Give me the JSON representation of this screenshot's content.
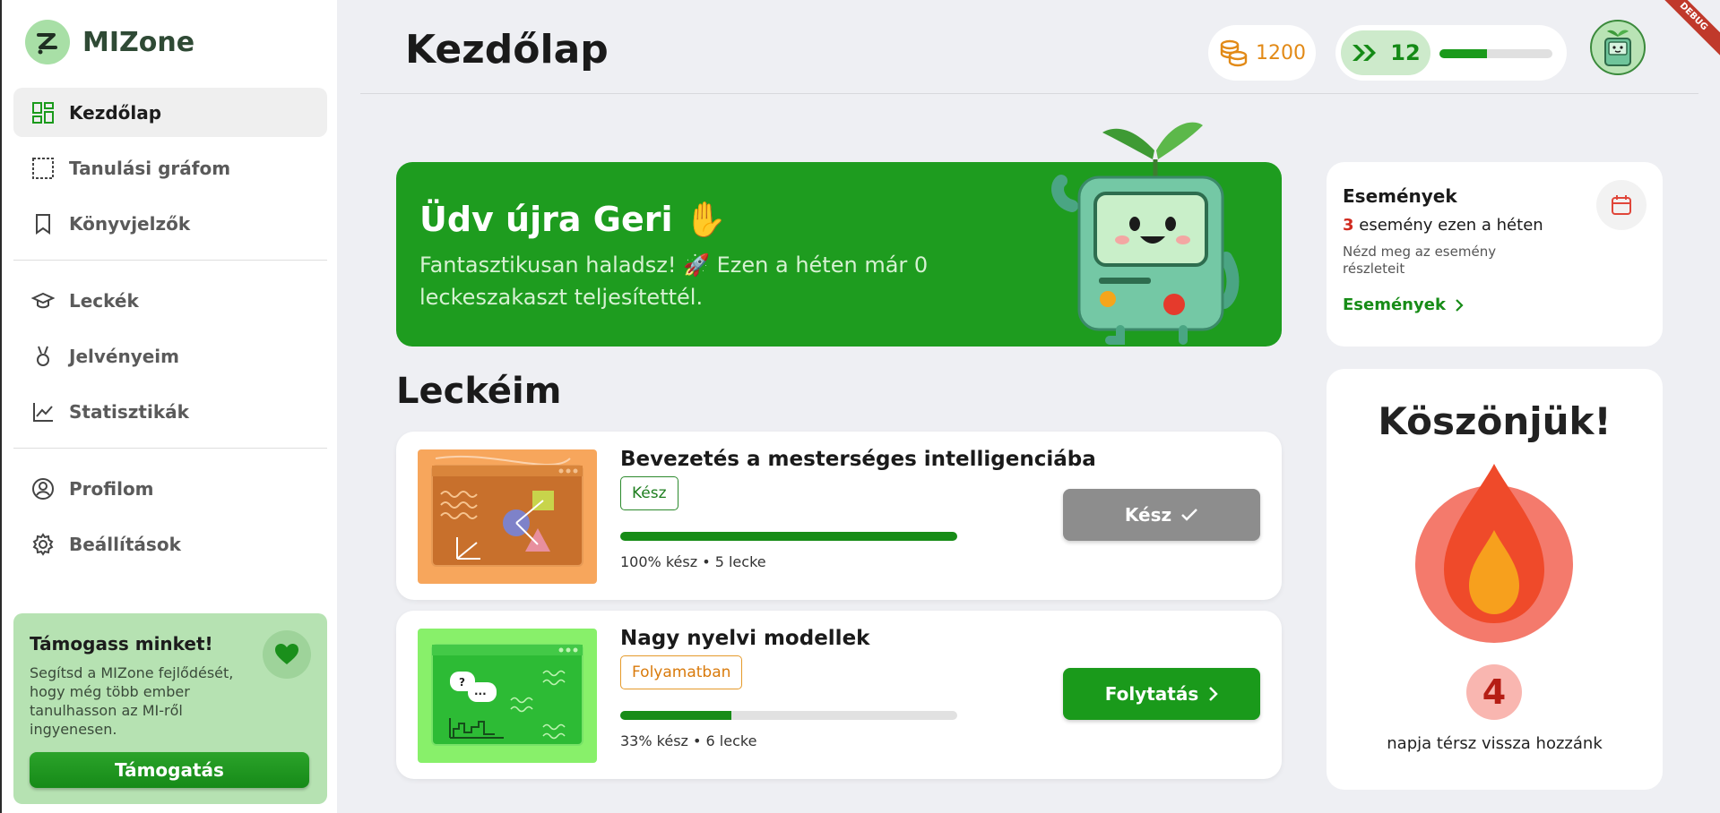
{
  "brand": {
    "name": "MIZone"
  },
  "sidebar": {
    "items": [
      {
        "label": "Kezdőlap",
        "icon": "dashboard-icon"
      },
      {
        "label": "Tanulási gráfom",
        "icon": "graph-frame-icon"
      },
      {
        "label": "Könyvjelzők",
        "icon": "bookmark-icon"
      },
      {
        "label": "Leckék",
        "icon": "graduation-cap-icon"
      },
      {
        "label": "Jelvényeim",
        "icon": "medal-icon"
      },
      {
        "label": "Statisztikák",
        "icon": "line-chart-icon"
      },
      {
        "label": "Profilom",
        "icon": "user-circle-icon"
      },
      {
        "label": "Beállítások",
        "icon": "gear-icon"
      }
    ]
  },
  "support": {
    "title": "Támogass minket!",
    "text": "Segítsd a MIZone fejlődését, hogy még több ember tanulhasson az MI-ről ingyenesen.",
    "button": "Támogatás"
  },
  "header": {
    "title": "Kezdőlap",
    "coins": "1200",
    "xp": "12",
    "xp_progress": 0.42,
    "debug": "DEBUG"
  },
  "welcome": {
    "title": "Üdv újra Geri ✋",
    "text": "Fantasztikusan haladsz! 🚀 Ezen a héten már 0 leckeszakaszt teljesítettél."
  },
  "lessons": {
    "title": "Leckéim",
    "items": [
      {
        "title": "Bevezetés a mesterséges intelligenciába",
        "badge": "Kész",
        "progress": 1.0,
        "meta": "100% kész • 5 lecke",
        "action": "Kész"
      },
      {
        "title": "Nagy nyelvi modellek",
        "badge": "Folyamatban",
        "progress": 0.33,
        "meta": "33% kész • 6 lecke",
        "action": "Folytatás"
      }
    ]
  },
  "events": {
    "title": "Események",
    "count": "3",
    "count_text": " esemény ezen a héten",
    "desc": "Nézd meg az esemény részleteit",
    "link": "Események"
  },
  "thanks": {
    "title": "Köszönjük!",
    "streak": "4",
    "streak_text": "napja térsz vissza hozzánk"
  },
  "colors": {
    "primary": "#1e9c1f",
    "coin": "#e28a17",
    "danger": "#d02a1f",
    "sidebar_bg": "#ffffff",
    "page_bg": "#eeeff3"
  }
}
